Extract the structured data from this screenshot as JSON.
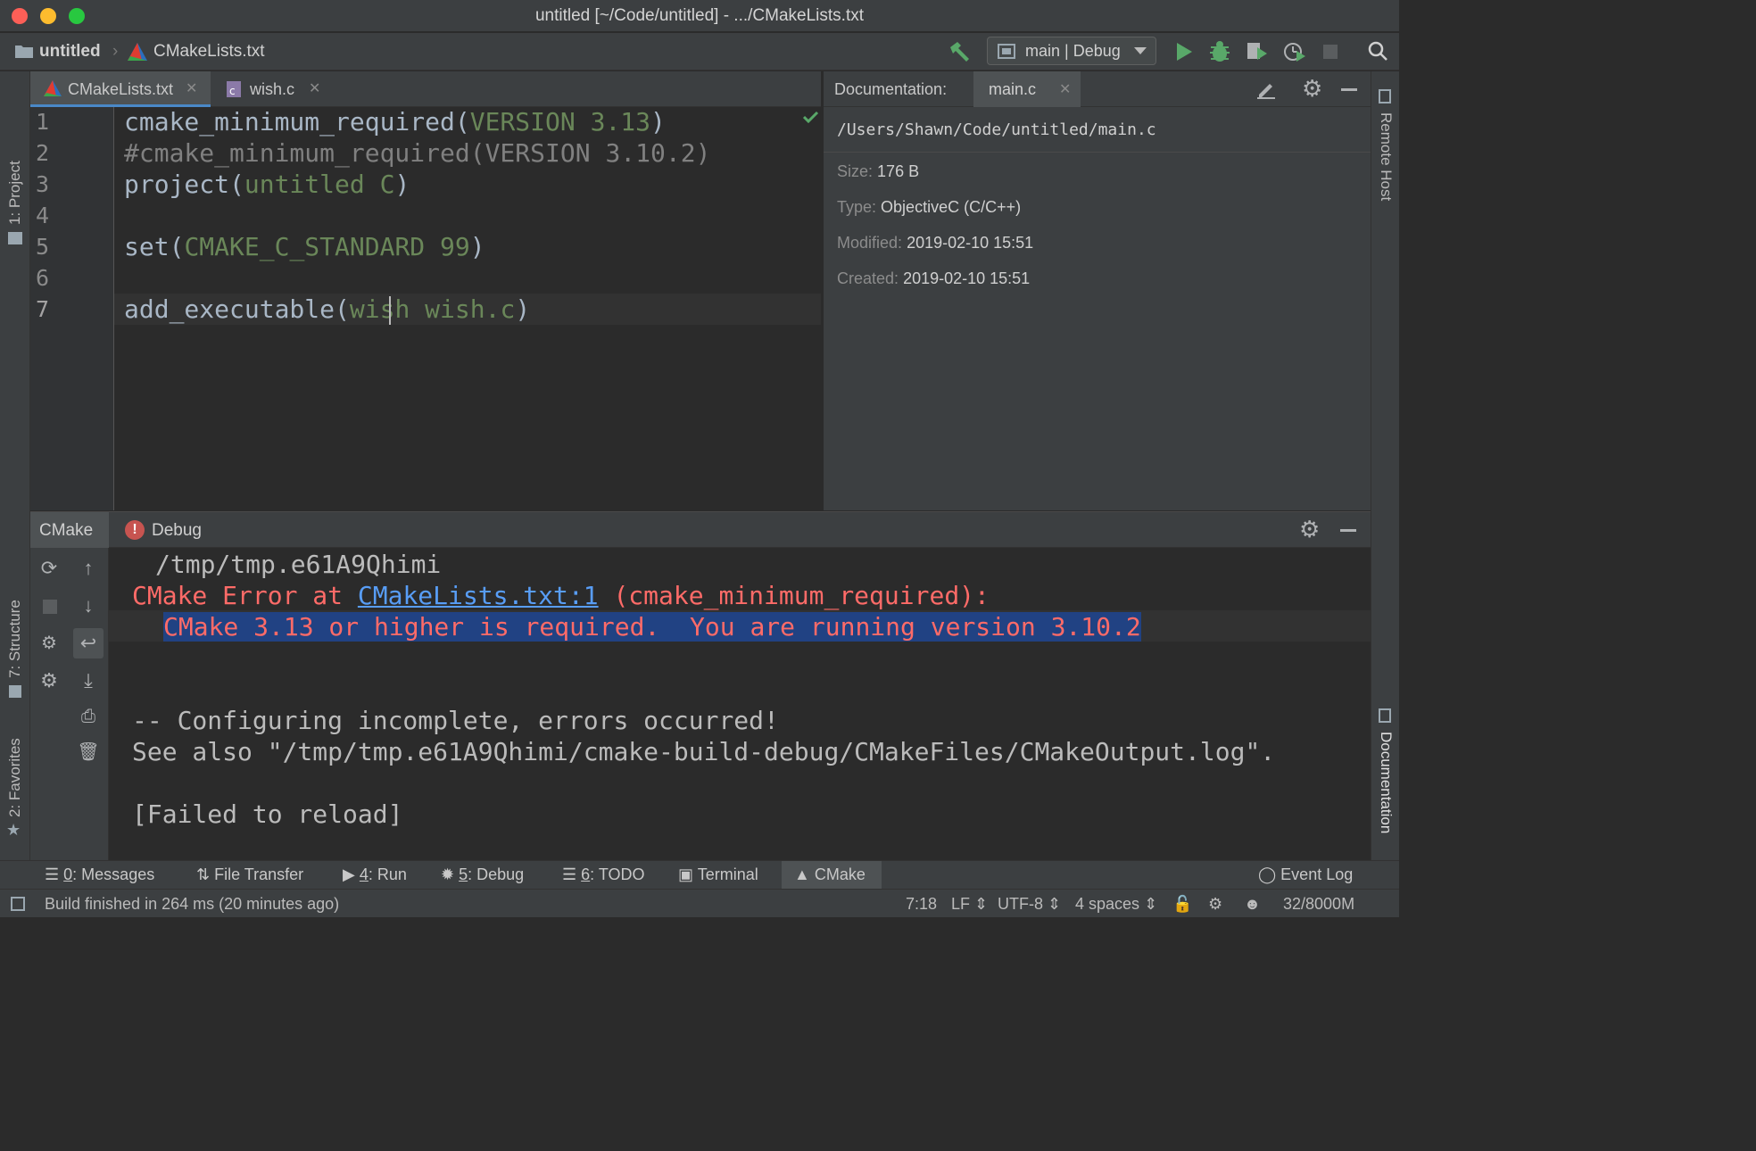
{
  "window": {
    "title": "untitled [~/Code/untitled] - .../CMakeLists.txt"
  },
  "nav": {
    "project": "untitled",
    "file": "CMakeLists.txt",
    "run_config": "main | Debug"
  },
  "left_strip": {
    "project": "1: Project",
    "structure": "7: Structure",
    "favorites": "2: Favorites"
  },
  "right_strip": {
    "remote": "Remote Host",
    "documentation": "Documentation"
  },
  "editor_tabs": [
    {
      "label": "CMakeLists.txt",
      "active": true
    },
    {
      "label": "wish.c",
      "active": false
    }
  ],
  "editor": {
    "line_numbers": [
      "1",
      "2",
      "3",
      "4",
      "5",
      "6",
      "7"
    ],
    "lines": {
      "l1_fn": "cmake_minimum_required(",
      "l1_arg": "VERSION 3.13",
      "l1_end": ")",
      "l2": "#cmake_minimum_required(VERSION 3.10.2)",
      "l3_fn": "project(",
      "l3_arg": "untitled C",
      "l3_end": ")",
      "l5_fn": "set(",
      "l5_arg": "CMAKE_C_STANDARD 99",
      "l5_end": ")",
      "l7_fn": "add_executable(",
      "l7_arg": "wish wish.c",
      "l7_end": ")"
    }
  },
  "documentation": {
    "label": "Documentation:",
    "tab": "main.c",
    "path": "/Users/Shawn/Code/untitled/main.c",
    "size_k": "Size:",
    "size_v": "176 B",
    "type_k": "Type:",
    "type_v": "ObjectiveC (C/C++)",
    "modified_k": "Modified:",
    "modified_v": "2019-02-10 15:51",
    "created_k": "Created:",
    "created_v": "2019-02-10 15:51"
  },
  "bottom": {
    "tab_cmake": "CMake",
    "tab_debug": "Debug",
    "console": {
      "l1": "/tmp/tmp.e61A9Qhimi",
      "l2_a": "CMake Error at ",
      "l2_link": "CMakeLists.txt:1",
      "l2_b": " (cmake_minimum_required):",
      "l3": "CMake 3.13 or higher is required.  You are running version 3.10.2",
      "l4": "-- Configuring incomplete, errors occurred!",
      "l5": "See also \"/tmp/tmp.e61A9Qhimi/cmake-build-debug/CMakeFiles/CMakeOutput.log\".",
      "l6": "[Failed to reload]"
    }
  },
  "tool_windows": {
    "messages_n": "0",
    "messages": ": Messages",
    "file_transfer": "File Transfer",
    "run_n": "4",
    "run": ": Run",
    "debug_n": "5",
    "debug": ": Debug",
    "todo_n": "6",
    "todo": ": TODO",
    "terminal": "Terminal",
    "cmake": "CMake",
    "event_log": "Event Log"
  },
  "status": {
    "message": "Build finished in 264 ms (20 minutes ago)",
    "position": "7:18",
    "line_sep": "LF",
    "encoding": "UTF-8",
    "indent": "4 spaces",
    "memory": "32/8000M"
  },
  "colors": {
    "keyword_arg": "#6a8759",
    "error": "#ff6b68",
    "selection": "#214283",
    "accent": "#4a88c7",
    "run_green": "#59a869"
  }
}
